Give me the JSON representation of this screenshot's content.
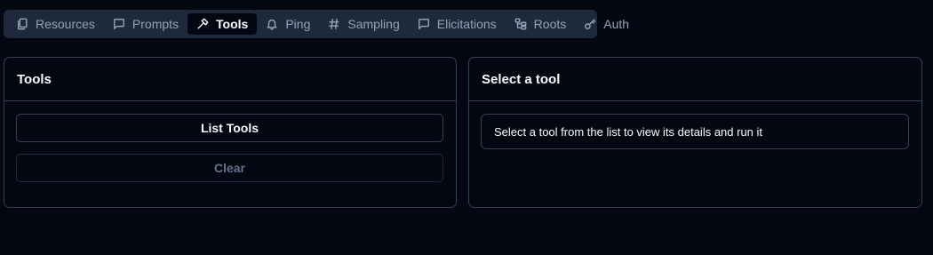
{
  "tabs": [
    {
      "label": "Resources",
      "icon": "files-icon",
      "active": false
    },
    {
      "label": "Prompts",
      "icon": "message-square-icon",
      "active": false
    },
    {
      "label": "Tools",
      "icon": "hammer-icon",
      "active": true
    },
    {
      "label": "Ping",
      "icon": "bell-icon",
      "active": false
    },
    {
      "label": "Sampling",
      "icon": "hash-icon",
      "active": false
    },
    {
      "label": "Elicitations",
      "icon": "message-square-icon",
      "active": false
    },
    {
      "label": "Roots",
      "icon": "folder-tree-icon",
      "active": false
    },
    {
      "label": "Auth",
      "icon": "key-icon",
      "active": false
    }
  ],
  "tools_panel": {
    "title": "Tools",
    "list_button": "List Tools",
    "clear_button": "Clear"
  },
  "detail_panel": {
    "title": "Select a tool",
    "message": "Select a tool from the list to view its details and run it"
  },
  "colors": {
    "background": "#030712",
    "tabbar": "#1e293b",
    "border": "#334155",
    "text": "#f8fafc",
    "muted_text": "#94a3b8"
  }
}
